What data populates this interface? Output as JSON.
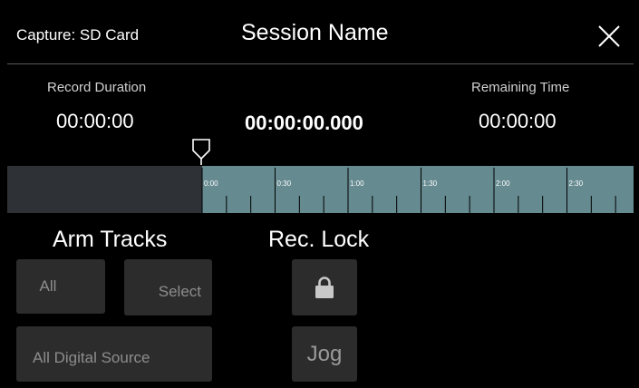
{
  "header": {
    "capture_label": "Capture: SD Card",
    "session_name": "Session Name"
  },
  "icons": {
    "close": "close-icon",
    "playhead": "playhead-marker-icon",
    "lock": "lock-icon"
  },
  "timer": {
    "record_duration_label": "Record Duration",
    "record_duration_value": "00:00:00",
    "current_time": "00:00:00.000",
    "remaining_time_label": "Remaining Time",
    "remaining_time_value": "00:00:00"
  },
  "timeline": {
    "tick_labels": [
      "0:00",
      "0:30",
      "1:00",
      "1:30",
      "2:00",
      "2:30"
    ]
  },
  "arm_tracks": {
    "title": "Arm Tracks",
    "all_label": "All",
    "select_label": "Select",
    "all_digital_label": "All Digital Source"
  },
  "rec_lock": {
    "title": "Rec. Lock",
    "jog_label": "Jog"
  },
  "colors": {
    "timeline_fill": "#658a90",
    "timeline_empty": "#2e3236",
    "button_bg": "#2c2c2c",
    "button_text": "#8d8d8d"
  }
}
